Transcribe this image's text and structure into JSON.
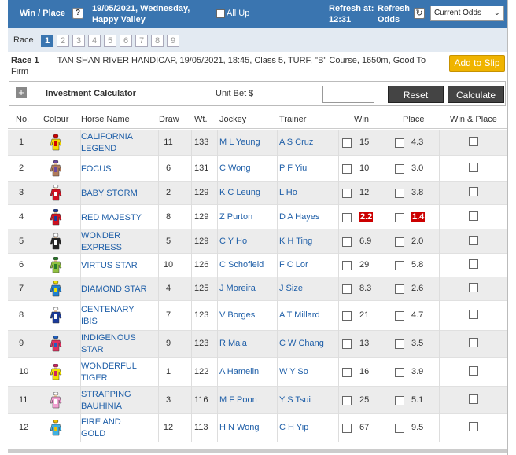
{
  "header": {
    "title": "Win / Place",
    "help_icon": "?",
    "date_line1": "19/05/2021, Wednesday,",
    "date_line2": "Happy Valley",
    "allup_label": "All Up",
    "refresh_label": "Refresh at:",
    "refresh_time": "12:31",
    "refresh_odds_line1": "Refresh",
    "refresh_odds_line2": "Odds",
    "odds_select_value": "Current Odds"
  },
  "race_tabs": {
    "label": "Race",
    "tabs": [
      "1",
      "2",
      "3",
      "4",
      "5",
      "6",
      "7",
      "8",
      "9"
    ],
    "active": "1"
  },
  "race_info": {
    "race_label": "Race 1",
    "description": "TAN SHAN RIVER HANDICAP, 19/05/2021, 18:45, Class 5, TURF, \"B\" Course, 1650m, Good To Firm"
  },
  "add_to_slip": "Add to Slip",
  "calculator": {
    "title": "Investment Calculator",
    "unit_bet_label": "Unit Bet $",
    "unit_bet_value": "",
    "reset_label": "Reset",
    "calculate_label": "Calculate"
  },
  "columns": {
    "no": "No.",
    "colour": "Colour",
    "horse": "Horse Name",
    "draw": "Draw",
    "wt": "Wt.",
    "jockey": "Jockey",
    "trainer": "Trainer",
    "win": "Win",
    "place": "Place",
    "winplace": "Win & Place"
  },
  "runners": [
    {
      "no": "1",
      "name1": "CALIFORNIA",
      "name2": "LEGEND",
      "draw": "11",
      "wt": "133",
      "jockey": "M L Yeung",
      "trainer": "A S Cruz",
      "win": "15",
      "place": "4.3",
      "hot": false,
      "silk": [
        "#f5d800",
        "#d00000"
      ]
    },
    {
      "no": "2",
      "name1": "FOCUS",
      "name2": "",
      "draw": "6",
      "wt": "131",
      "jockey": "C Wong",
      "trainer": "P F Yiu",
      "win": "10",
      "place": "3.0",
      "hot": false,
      "silk": [
        "#b07a5a",
        "#6a4aa0"
      ]
    },
    {
      "no": "3",
      "name1": "BABY STORM",
      "name2": "",
      "draw": "2",
      "wt": "129",
      "jockey": "K C Leung",
      "trainer": "L Ho",
      "win": "12",
      "place": "3.8",
      "hot": false,
      "silk": [
        "#d01020",
        "#ffffff"
      ]
    },
    {
      "no": "4",
      "name1": "RED MAJESTY",
      "name2": "",
      "draw": "8",
      "wt": "129",
      "jockey": "Z Purton",
      "trainer": "D A Hayes",
      "win": "2.2",
      "place": "1.4",
      "hot": true,
      "silk": [
        "#d01020",
        "#1a3a9a"
      ]
    },
    {
      "no": "5",
      "name1": "WONDER",
      "name2": "EXPRESS",
      "draw": "5",
      "wt": "129",
      "jockey": "C Y Ho",
      "trainer": "K H Ting",
      "win": "6.9",
      "place": "2.0",
      "hot": false,
      "silk": [
        "#222222",
        "#ffffff"
      ]
    },
    {
      "no": "6",
      "name1": "VIRTUS STAR",
      "name2": "",
      "draw": "10",
      "wt": "126",
      "jockey": "C Schofield",
      "trainer": "F C Lor",
      "win": "29",
      "place": "5.8",
      "hot": false,
      "silk": [
        "#90c040",
        "#2a7a2a"
      ]
    },
    {
      "no": "7",
      "name1": "DIAMOND STAR",
      "name2": "",
      "draw": "4",
      "wt": "125",
      "jockey": "J Moreira",
      "trainer": "J Size",
      "win": "8.3",
      "place": "2.6",
      "hot": false,
      "silk": [
        "#2080d0",
        "#f0e000"
      ]
    },
    {
      "no": "8",
      "name1": "CENTENARY",
      "name2": "IBIS",
      "draw": "7",
      "wt": "123",
      "jockey": "V Borges",
      "trainer": "A T Millard",
      "win": "21",
      "place": "4.7",
      "hot": false,
      "silk": [
        "#1a3a9a",
        "#ffffff"
      ]
    },
    {
      "no": "9",
      "name1": "INDIGENOUS",
      "name2": "STAR",
      "draw": "9",
      "wt": "123",
      "jockey": "R Maia",
      "trainer": "C W Chang",
      "win": "13",
      "place": "3.5",
      "hot": false,
      "silk": [
        "#e03060",
        "#2060c0"
      ]
    },
    {
      "no": "10",
      "name1": "WONDERFUL",
      "name2": "TIGER",
      "draw": "1",
      "wt": "122",
      "jockey": "A Hamelin",
      "trainer": "W Y So",
      "win": "16",
      "place": "3.9",
      "hot": false,
      "silk": [
        "#f0e000",
        "#d02060"
      ]
    },
    {
      "no": "11",
      "name1": "STRAPPING",
      "name2": "BAUHINIA",
      "draw": "3",
      "wt": "116",
      "jockey": "M F Poon",
      "trainer": "Y S Tsui",
      "win": "25",
      "place": "5.1",
      "hot": false,
      "silk": [
        "#f0a0d0",
        "#ffffff"
      ]
    },
    {
      "no": "12",
      "name1": "FIRE AND",
      "name2": "GOLD",
      "draw": "12",
      "wt": "113",
      "jockey": "H N Wong",
      "trainer": "C H Yip",
      "win": "67",
      "place": "9.5",
      "hot": false,
      "silk": [
        "#40b0e0",
        "#f0c000"
      ]
    }
  ]
}
